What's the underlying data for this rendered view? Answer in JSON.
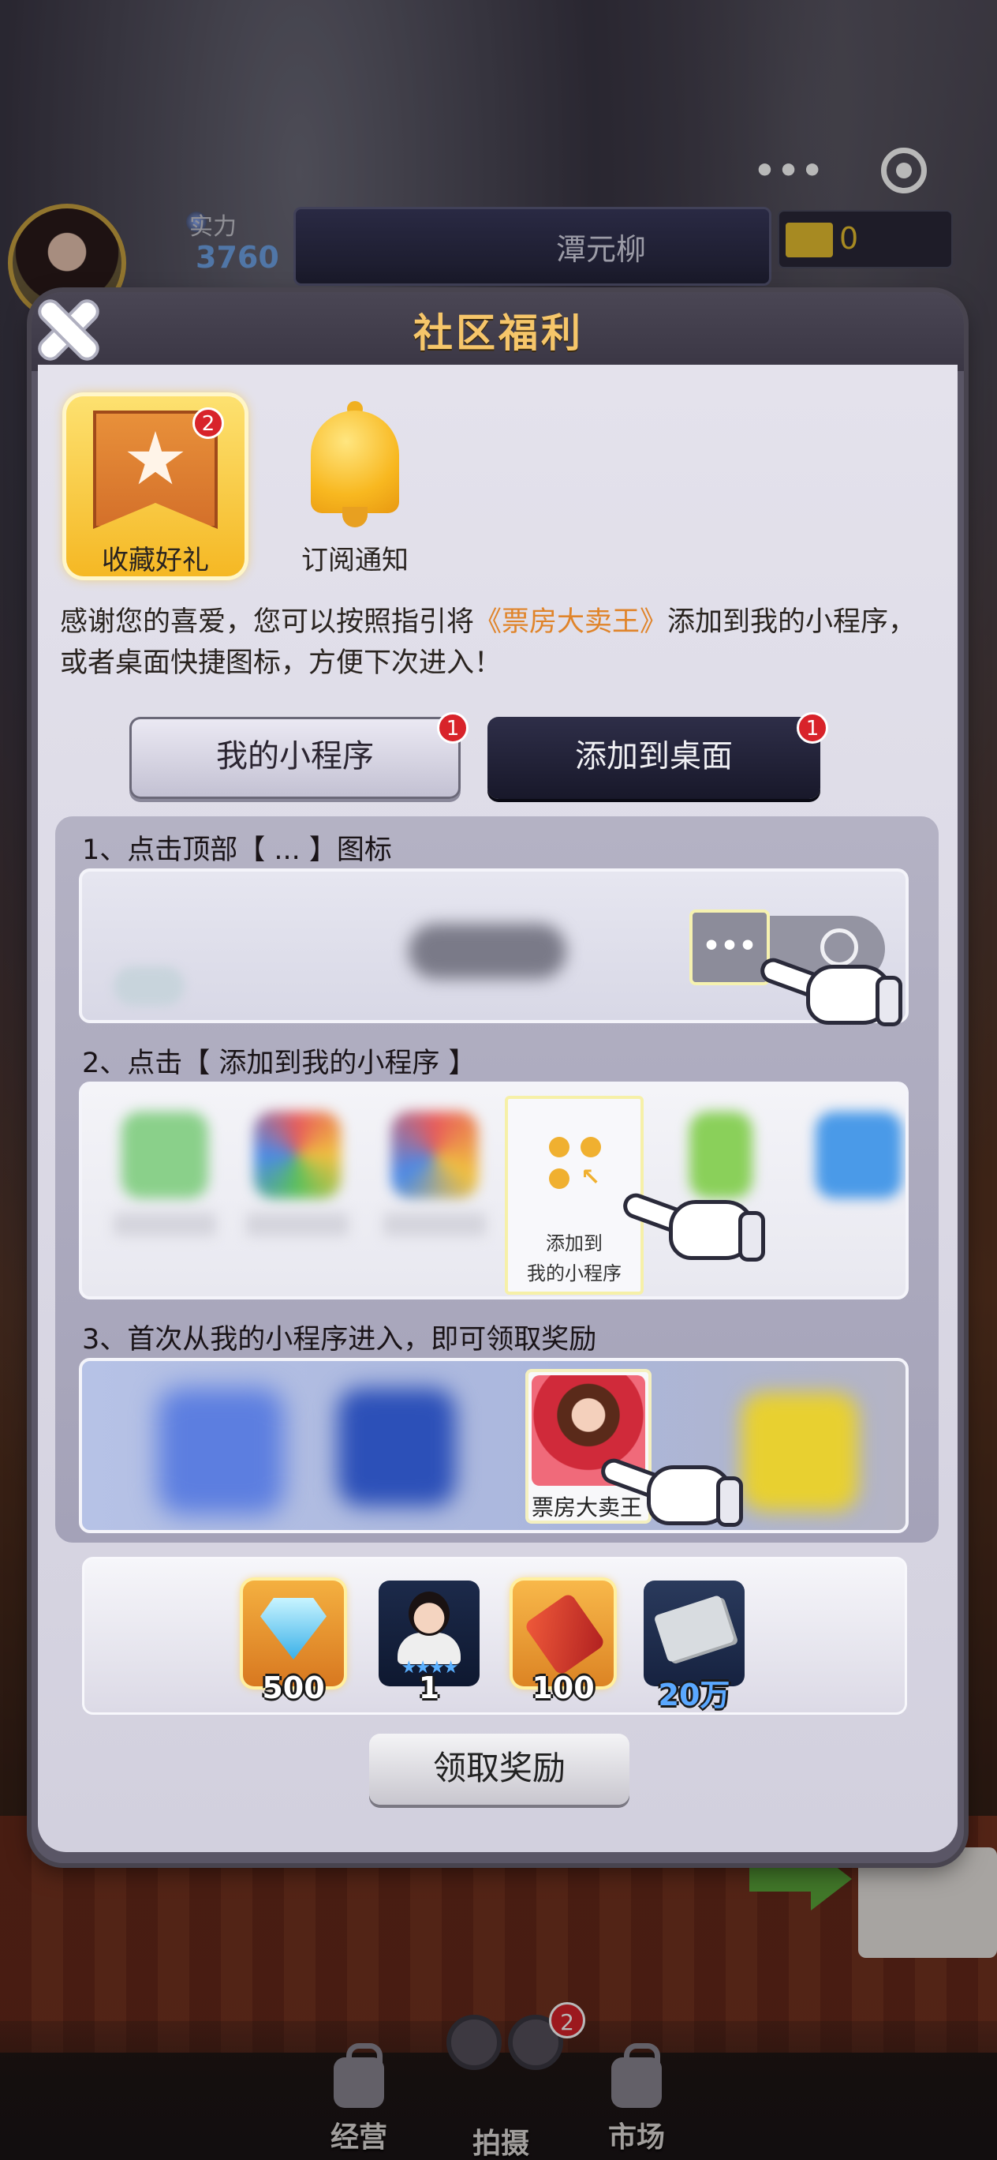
{
  "hud": {
    "power_label": "实力",
    "power_value": "3760",
    "player_name": "潭元柳",
    "ticket_count": "0",
    "capsule_menu": "•••"
  },
  "modal": {
    "title": "社区福利",
    "tabs": [
      {
        "label": "收藏好礼",
        "badge": "2",
        "icon": "bookmark-star-icon",
        "active": true
      },
      {
        "label": "订阅通知",
        "icon": "bell-icon",
        "active": false
      }
    ],
    "intro_pre": "感谢您的喜爱，您可以按照指引将",
    "intro_highlight": "《票房大卖王》",
    "intro_post": "添加到我的小程序，或者桌面快捷图标，方便下次进入！",
    "buttons": {
      "mini_program": {
        "label": "我的小程序",
        "badge": "1"
      },
      "desktop": {
        "label": "添加到桌面",
        "badge": "1"
      }
    },
    "steps": [
      {
        "text": "1、点击顶部【 ... 】图标",
        "dots": "•••"
      },
      {
        "text": "2、点击【 添加到我的小程序 】",
        "card_line1": "添加到",
        "card_line2": "我的小程序"
      },
      {
        "text": "3、首次从我的小程序进入，即可领取奖励",
        "card_caption": "票房大卖王"
      }
    ],
    "rewards": [
      {
        "icon": "diamond-icon",
        "value": "500"
      },
      {
        "icon": "character-icon",
        "value": "1",
        "stars": "★★★★"
      },
      {
        "icon": "rocket-icon",
        "value": "100"
      },
      {
        "icon": "money-icon",
        "value": "20万"
      }
    ],
    "claim_label": "领取奖励"
  },
  "bottom_nav": {
    "items": [
      {
        "label": "经营",
        "locked": true
      },
      {
        "label": "拍摄",
        "badge": "2"
      },
      {
        "label": "市场",
        "locked": true
      }
    ]
  },
  "colors": {
    "title": "#f6c66a",
    "highlight": "#e0842a",
    "badge": "#d8232a"
  }
}
